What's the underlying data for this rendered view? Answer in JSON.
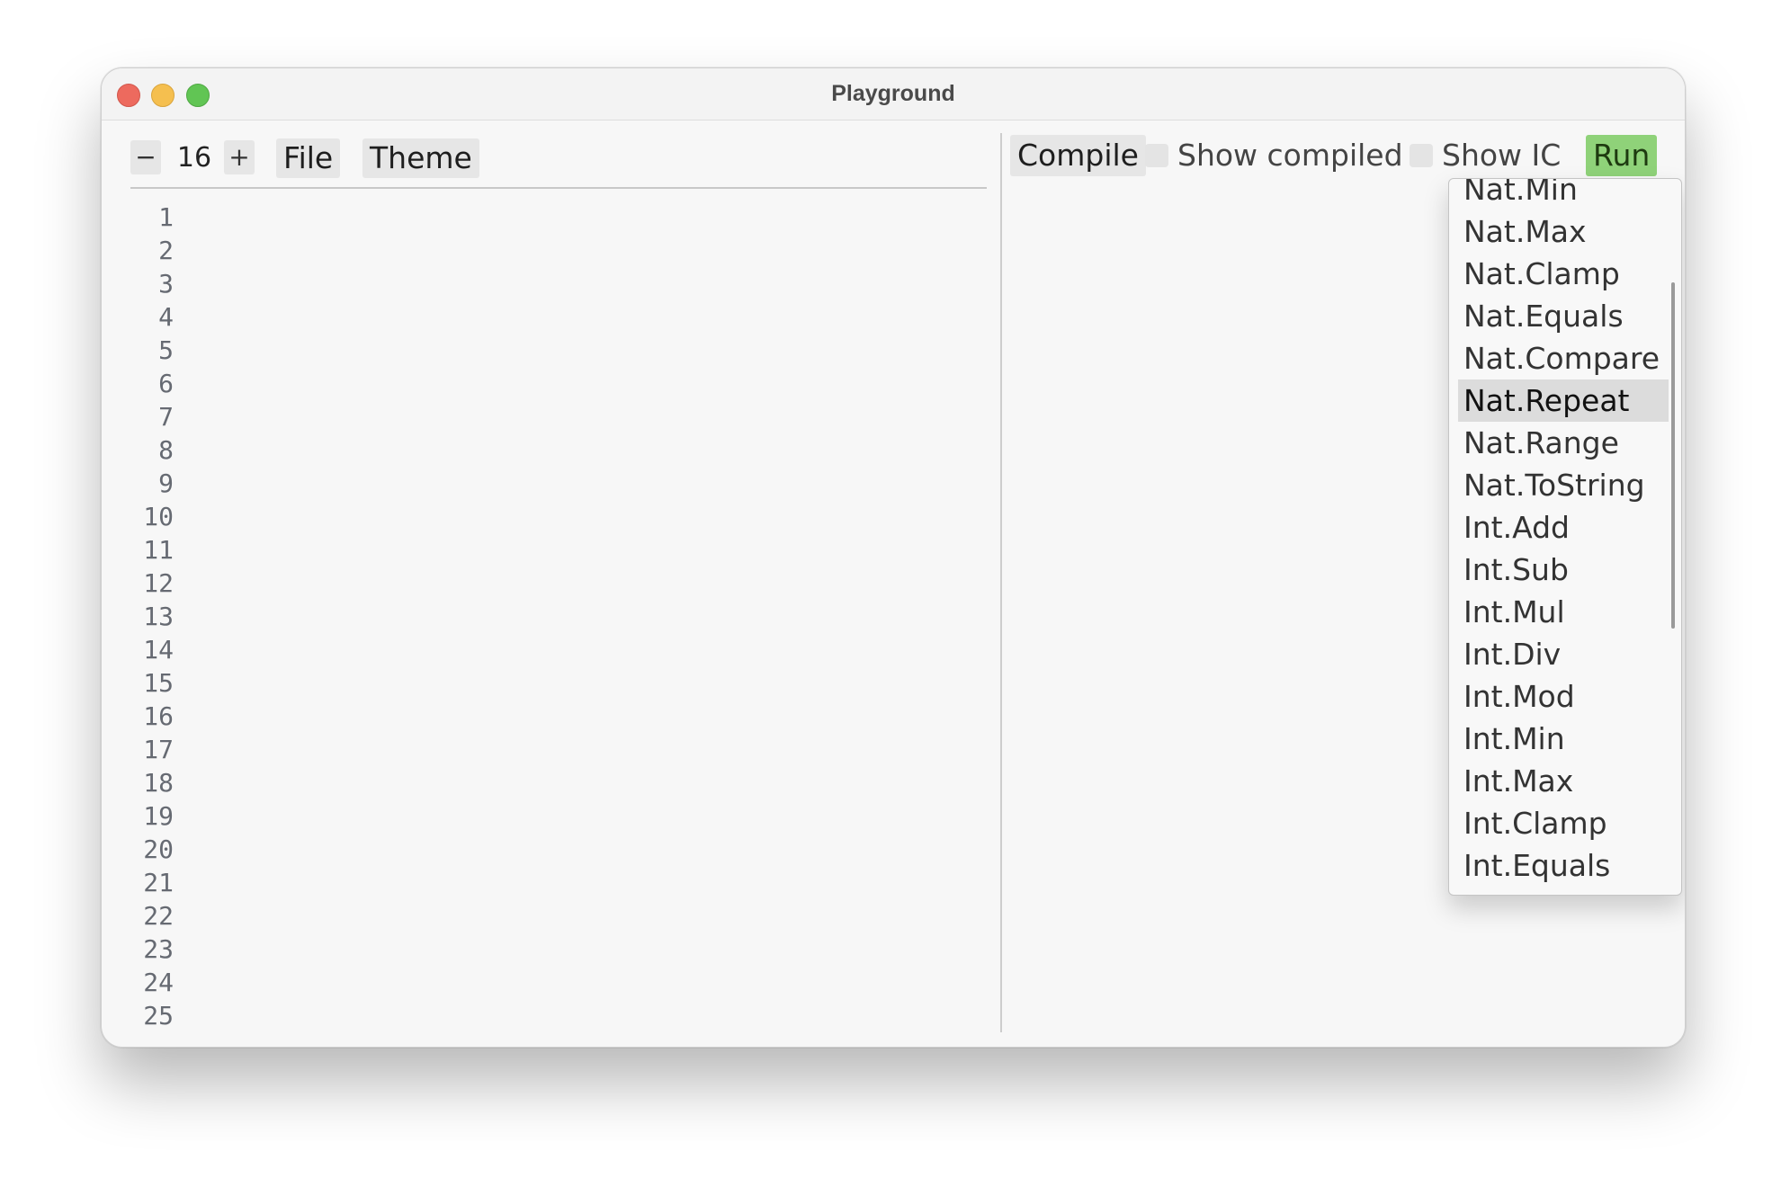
{
  "window": {
    "title": "Playground"
  },
  "editor": {
    "font_decrease_label": "−",
    "font_size": "16",
    "font_increase_label": "+",
    "file_menu_label": "File",
    "theme_menu_label": "Theme",
    "line_numbers": [
      "1",
      "2",
      "3",
      "4",
      "5",
      "6",
      "7",
      "8",
      "9",
      "10",
      "11",
      "12",
      "13",
      "14",
      "15",
      "16",
      "17",
      "18",
      "19",
      "20",
      "21",
      "22",
      "23",
      "24",
      "25"
    ]
  },
  "output": {
    "compile_label": "Compile",
    "show_compiled_label": "Show compiled",
    "show_ic_label": "Show IC",
    "run_label": "Run"
  },
  "dropdown": {
    "selected": "Nat.Repeat",
    "items": [
      "Nat.Min",
      "Nat.Max",
      "Nat.Clamp",
      "Nat.Equals",
      "Nat.Compare",
      "Nat.Repeat",
      "Nat.Range",
      "Nat.ToString",
      "Int.Add",
      "Int.Sub",
      "Int.Mul",
      "Int.Div",
      "Int.Mod",
      "Int.Min",
      "Int.Max",
      "Int.Clamp",
      "Int.Equals"
    ]
  },
  "colors": {
    "run_button": "#8fd279",
    "close": "#ed6a5e",
    "minimize": "#f5bf4f",
    "maximize": "#61c554"
  }
}
